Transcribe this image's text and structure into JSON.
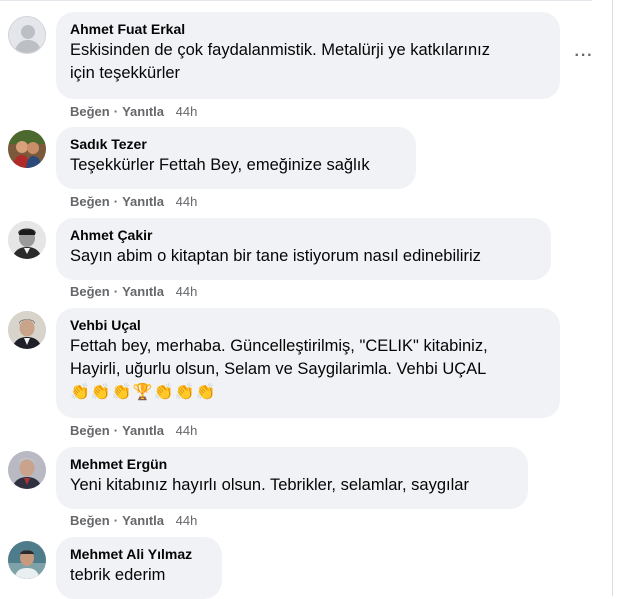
{
  "comments": [
    {
      "author": "Ahmet Fuat Erkal",
      "lines": [
        "Eskisinden de çok faydalanmistik. Metalürji ye katkılarınız",
        "için teşekkürler"
      ],
      "like": "Beğen",
      "reply": "Yanıtla",
      "time": "44h",
      "more": "···"
    },
    {
      "author": "Sadık Tezer",
      "lines": [
        "Teşekkürler Fettah Bey, emeğinize sağlık"
      ],
      "like": "Beğen",
      "reply": "Yanıtla",
      "time": "44h"
    },
    {
      "author": "Ahmet Çakir",
      "lines": [
        "Sayın abim o kitaptan bir tane istiyorum nasıl edinebiliriz"
      ],
      "like": "Beğen",
      "reply": "Yanıtla",
      "time": "44h"
    },
    {
      "author": "Vehbi Uçal",
      "lines": [
        "Fettah bey, merhaba. Güncelleştirilmiş, \"CELIK\" kitabiniz,",
        "Hayirli, uğurlu olsun, Selam ve Saygilarimla. Vehbi UÇAL"
      ],
      "emojis": [
        "👏",
        "👏",
        "👏",
        "🏆",
        "👏",
        "👏",
        "👏"
      ],
      "like": "Beğen",
      "reply": "Yanıtla",
      "time": "44h"
    },
    {
      "author": "Mehmet Ergün",
      "lines": [
        "Yeni kitabınız hayırlı olsun. Tebrikler, selamlar, saygılar"
      ],
      "like": "Beğen",
      "reply": "Yanıtla",
      "time": "44h"
    },
    {
      "author": "Mehmet Ali Yılmaz",
      "lines": [
        "tebrik ederim"
      ]
    }
  ],
  "separator": "·",
  "colors": {
    "bubble": "#f0f2f5",
    "meta": "#65676b",
    "text": "#050505"
  }
}
